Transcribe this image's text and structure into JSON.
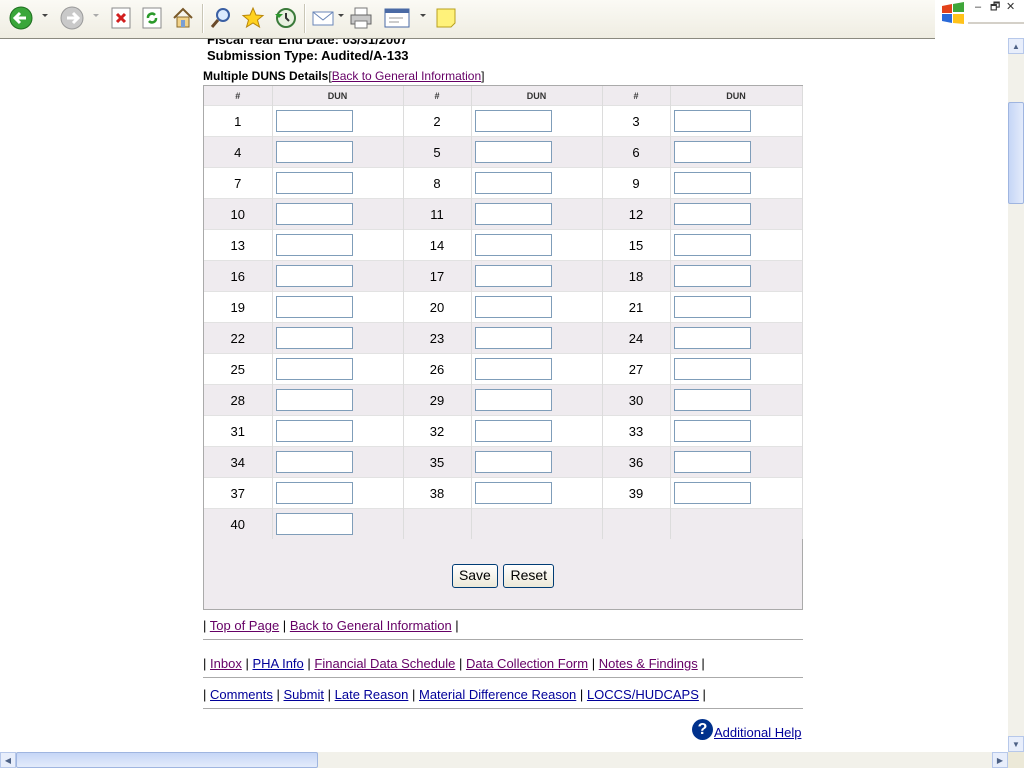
{
  "browser": {
    "toolbar_icons": [
      "back-icon",
      "forward-icon",
      "stop-icon",
      "refresh-icon",
      "home-icon",
      "search-icon",
      "favorites-icon",
      "history-icon",
      "mail-icon",
      "print-icon",
      "edit-icon",
      "note-icon"
    ],
    "window_controls": {
      "minimize": "–",
      "restore": "🗗",
      "close": "✕"
    }
  },
  "header": {
    "fiscal_line": "Fiscal Year End Date: 03/31/2007",
    "submission_line": "Submission Type: Audited/A-133"
  },
  "duns": {
    "heading": "Multiple DUNS Details",
    "back_link_open": "[",
    "back_link": "Back to General Information",
    "back_link_close": "]",
    "col_num_header": "#",
    "col_dun_header": "DUN",
    "rows": [
      [
        "1",
        "2",
        "3"
      ],
      [
        "4",
        "5",
        "6"
      ],
      [
        "7",
        "8",
        "9"
      ],
      [
        "10",
        "11",
        "12"
      ],
      [
        "13",
        "14",
        "15"
      ],
      [
        "16",
        "17",
        "18"
      ],
      [
        "19",
        "20",
        "21"
      ],
      [
        "22",
        "23",
        "24"
      ],
      [
        "25",
        "26",
        "27"
      ],
      [
        "28",
        "29",
        "30"
      ],
      [
        "31",
        "32",
        "33"
      ],
      [
        "34",
        "35",
        "36"
      ],
      [
        "37",
        "38",
        "39"
      ],
      [
        "40",
        "",
        ""
      ]
    ],
    "save_label": "Save",
    "reset_label": "Reset"
  },
  "nav_top": {
    "sep": "|",
    "links": [
      "Top of Page",
      "Back to General Information"
    ]
  },
  "nav_main": {
    "links": [
      "Inbox",
      "PHA Info",
      "Financial Data Schedule",
      "Data Collection Form",
      "Notes & Findings"
    ]
  },
  "nav_secondary": {
    "links": [
      "Comments",
      "Submit",
      "Late Reason",
      "Material Difference Reason",
      "LOCCS/HUDCAPS"
    ]
  },
  "help": {
    "icon": "?",
    "label": "Additional Help"
  }
}
